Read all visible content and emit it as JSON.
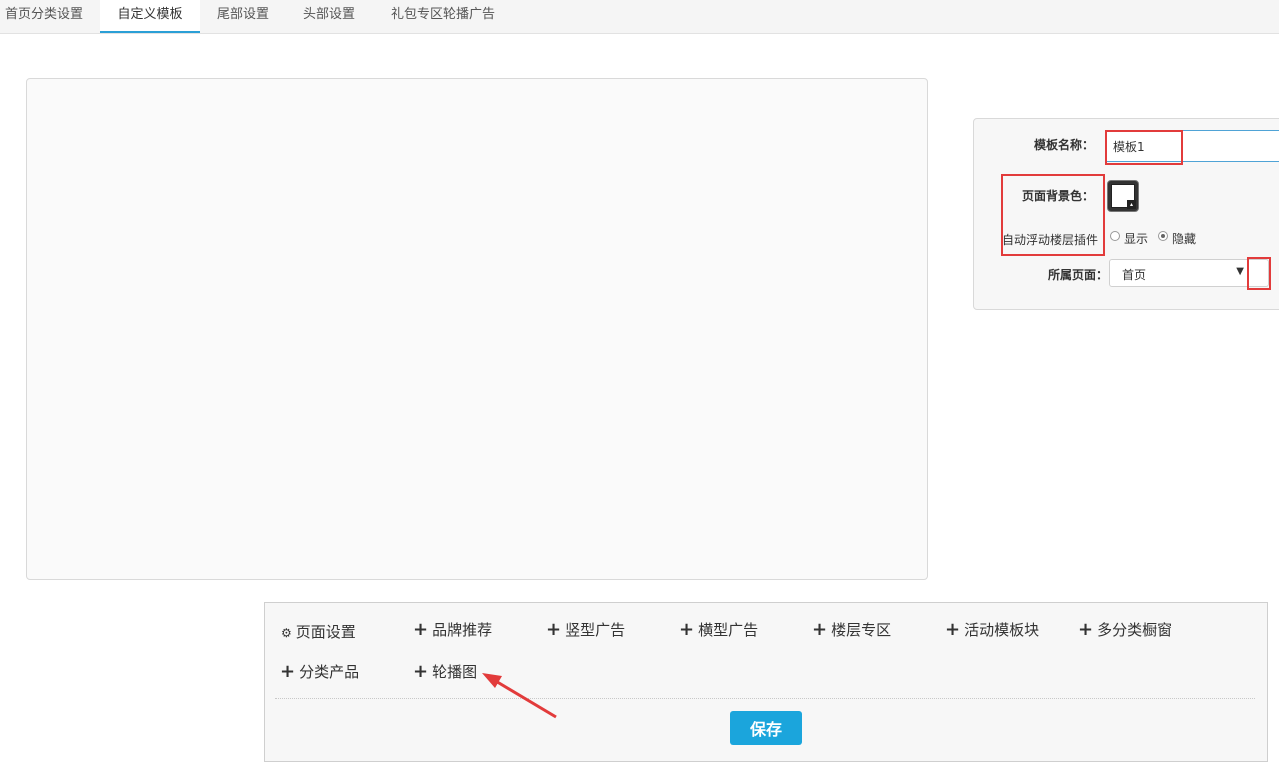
{
  "tabs": [
    {
      "label": "首页分类设置",
      "active": false
    },
    {
      "label": "自定义模板",
      "active": true
    },
    {
      "label": "尾部设置",
      "active": false
    },
    {
      "label": "头部设置",
      "active": false
    },
    {
      "label": "礼包专区轮播广告",
      "active": false
    }
  ],
  "settings": {
    "template_name_label": "模板名称：",
    "template_name_value": "模板1",
    "bg_color_label": "页面背景色：",
    "bg_color_value": "#ffffff",
    "float_plugin_label": "自动浮动楼层插件",
    "float_show_label": "显示",
    "float_hide_label": "隐藏",
    "float_selected": "隐藏",
    "page_label": "所属页面：",
    "page_value": "首页"
  },
  "toolbox": {
    "items": [
      {
        "label": "页面设置",
        "icon": "gear-icon"
      },
      {
        "label": "品牌推荐",
        "icon": "plus-icon"
      },
      {
        "label": "竖型广告",
        "icon": "plus-icon"
      },
      {
        "label": "横型广告",
        "icon": "plus-icon"
      },
      {
        "label": "楼层专区",
        "icon": "plus-icon"
      },
      {
        "label": "活动模板块",
        "icon": "plus-icon"
      },
      {
        "label": "多分类橱窗",
        "icon": "plus-icon"
      },
      {
        "label": "分类产品",
        "icon": "plus-icon"
      },
      {
        "label": "轮播图",
        "icon": "plus-icon"
      }
    ],
    "save_label": "保存"
  },
  "colors": {
    "accent": "#2a9fd6",
    "save_button": "#1ba5dc",
    "highlight": "#e23b3b"
  }
}
